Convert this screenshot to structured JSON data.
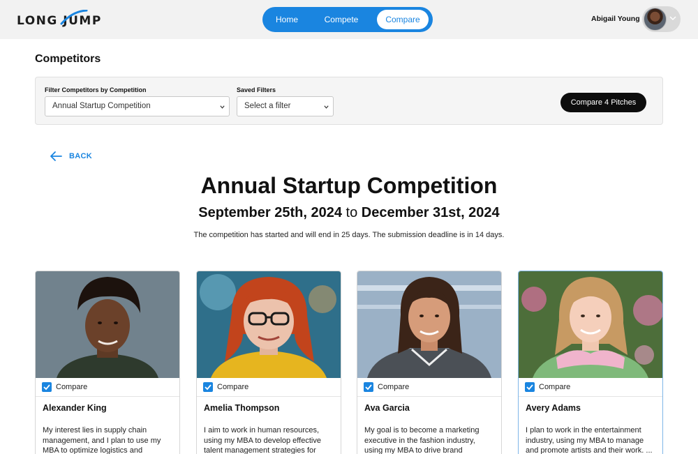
{
  "header": {
    "logo_text": "LONG JUMP",
    "nav": [
      {
        "label": "Home",
        "active": false
      },
      {
        "label": "Compete",
        "active": false
      },
      {
        "label": "Compare",
        "active": true
      }
    ],
    "user_name": "Abigail Young",
    "accent_color": "#1a85e0"
  },
  "page": {
    "title": "Competitors"
  },
  "filters": {
    "competition_label": "Filter Competitors by Competition",
    "competition_value": "Annual Startup Competition",
    "saved_label": "Saved Filters",
    "saved_value": "Select a filter",
    "compare_button": "Compare 4 Pitches"
  },
  "back_label": "BACK",
  "competition": {
    "title": "Annual Startup Competition",
    "start_date": "September 25th, 2024",
    "date_connector": "to",
    "end_date": "December 31st, 2024",
    "note": "The competition has started and will end in 25 days. The submission deadline is in 14 days."
  },
  "cards": [
    {
      "name": "Alexander King",
      "compare_label": "Compare",
      "checked": true,
      "description": "My interest lies in supply chain management, and I plan to use my MBA to optimize logistics and"
    },
    {
      "name": "Amelia Thompson",
      "compare_label": "Compare",
      "checked": true,
      "description": "I aim to work in human resources, using my MBA to develop effective talent management strategies for"
    },
    {
      "name": "Ava Garcia",
      "compare_label": "Compare",
      "checked": true,
      "description": "My goal is to become a marketing executive in the fashion industry, using my MBA to drive brand"
    },
    {
      "name": "Avery Adams",
      "compare_label": "Compare",
      "checked": true,
      "description": "I plan to work in the entertainment industry, using my MBA to manage and promote artists and their work. ..."
    }
  ]
}
